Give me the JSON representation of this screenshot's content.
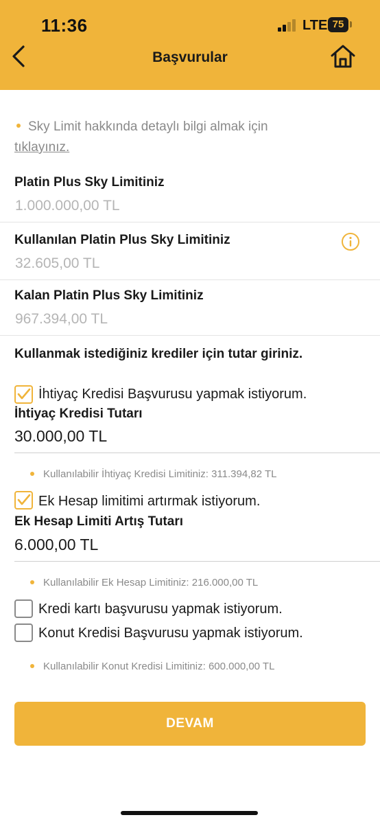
{
  "status_bar": {
    "time": "11:36",
    "network": "LTE",
    "battery": "75"
  },
  "header": {
    "title": "Başvurular",
    "back_icon": "chevron-left-icon",
    "home_icon": "home-icon",
    "background_color": "#f0b43a"
  },
  "info": {
    "text": "Sky Limit hakkında detaylı bilgi almak için",
    "link": "tıklayınız."
  },
  "limits": [
    {
      "label": "Platin Plus Sky Limitiniz",
      "value": "1.000.000,00 TL"
    },
    {
      "label": "Kullanılan Platin Plus Sky Limitiniz",
      "value": "32.605,00 TL"
    },
    {
      "label": "Kalan Platin Plus Sky Limitiniz",
      "value": "967.394,00 TL"
    }
  ],
  "section_title": "Kullanmak istediğiniz krediler için tutar giriniz.",
  "options": {
    "ihtiyac": {
      "checked": true,
      "label": "İhtiyaç Kredisi Başvurusu yapmak istiyorum.",
      "amount_label": "İhtiyaç Kredisi Tutarı",
      "amount_value": "30.000,00 TL",
      "hint": "Kullanılabilir İhtiyaç Kredisi Limitiniz: 311.394,82 TL"
    },
    "ek_hesap": {
      "checked": true,
      "label": "Ek Hesap limitimi artırmak istiyorum.",
      "amount_label": "Ek Hesap Limiti Artış Tutarı",
      "amount_value": "6.000,00 TL",
      "hint": "Kullanılabilir Ek Hesap Limitiniz: 216.000,00 TL"
    },
    "kredi_karti": {
      "checked": false,
      "label": "Kredi kartı başvurusu yapmak istiyorum."
    },
    "konut": {
      "checked": false,
      "label": "Konut Kredisi Başvurusu yapmak istiyorum.",
      "hint": "Kullanılabilir Konut Kredisi Limitiniz: 600.000,00 TL"
    }
  },
  "continue_button": "DEVAM"
}
